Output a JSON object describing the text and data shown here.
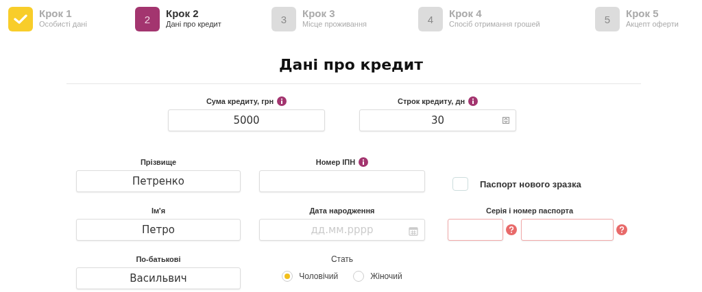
{
  "steps": [
    {
      "title": "Крок 1",
      "subtitle": "Особисті дані",
      "completed": true,
      "selected": false
    },
    {
      "number": "2",
      "title": "Крок 2",
      "subtitle": "Дані про кредит",
      "completed": false,
      "selected": true
    },
    {
      "number": "3",
      "title": "Крок 3",
      "subtitle": "Місце проживання",
      "completed": false,
      "selected": false
    },
    {
      "number": "4",
      "title": "Крок 4",
      "subtitle": "Спосіб отримання грошей",
      "completed": false,
      "selected": false
    },
    {
      "number": "5",
      "title": "Крок 5",
      "subtitle": "Акцепт оферти",
      "completed": false,
      "selected": false
    }
  ],
  "heading": "Дані про кредит",
  "loan_fields": [
    {
      "label": "Сума кредиту, грн",
      "info": true,
      "value": "5000",
      "kind": "text"
    },
    {
      "label": "Строк кредиту, дн",
      "info": true,
      "value": "30",
      "kind": "spinner"
    }
  ],
  "left_column": [
    {
      "label": "Прізвище",
      "value": "Петренко"
    },
    {
      "label": "Ім'я",
      "value": "Петро"
    },
    {
      "label": "По-батькові",
      "value": "Васильвич"
    }
  ],
  "middle_column": {
    "tax_number": {
      "label": "Номер ІПН",
      "info": true
    },
    "birth_date": {
      "label": "Дата народження",
      "placeholder": "дд.мм.рррр"
    },
    "gender": {
      "label": "Стать",
      "options": [
        {
          "label": "Чоловічий",
          "selected": true
        },
        {
          "label": "Жіночий",
          "selected": false
        }
      ]
    }
  },
  "passport": {
    "new_passport": {
      "label": "Паспорт нового зразка",
      "checked": false
    },
    "series_number": {
      "label": "Серія і номер паспорта",
      "fields": [
        {
          "invalid": true
        },
        {
          "invalid": true
        }
      ]
    }
  }
}
